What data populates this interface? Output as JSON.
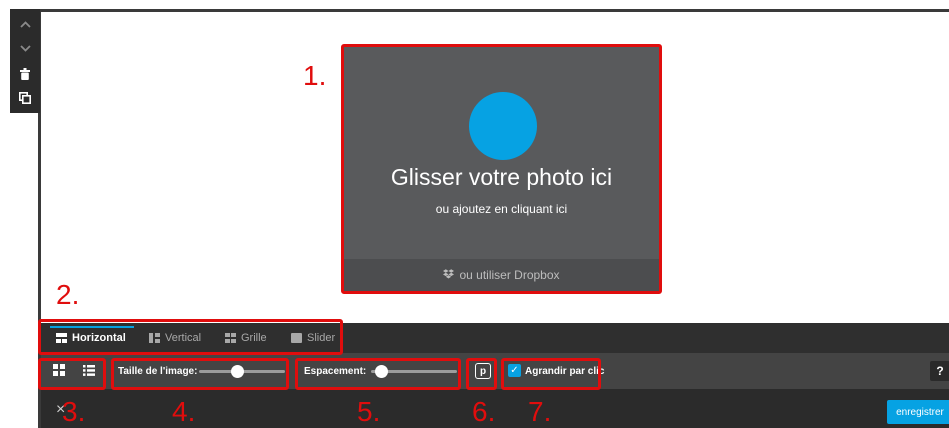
{
  "upload": {
    "main_text": "Glisser votre photo ici",
    "sub_text": "ou ajoutez en cliquant ici",
    "dropbox_label": "ou utiliser Dropbox"
  },
  "annotations": [
    "1.",
    "2.",
    "3.",
    "4.",
    "5.",
    "6.",
    "7."
  ],
  "layout_tabs": [
    {
      "label": "Horizontal",
      "active": true
    },
    {
      "label": "Vertical",
      "active": false
    },
    {
      "label": "Grille",
      "active": false
    },
    {
      "label": "Slider",
      "active": false
    }
  ],
  "options": {
    "image_size_label": "Taille de l'image:",
    "image_size_value": 0.45,
    "spacing_label": "Espacement:",
    "spacing_value": 0.12,
    "enlarge_label": "Agrandir par clic",
    "enlarge_checked": true,
    "help_label": "?"
  },
  "footer": {
    "close_label": "×",
    "save_label": "enregistrer"
  },
  "colors": {
    "accent": "#06a2e3",
    "annotation": "#e00d0d",
    "dark_bar": "#2f2f2f",
    "options_bar": "#444444"
  }
}
